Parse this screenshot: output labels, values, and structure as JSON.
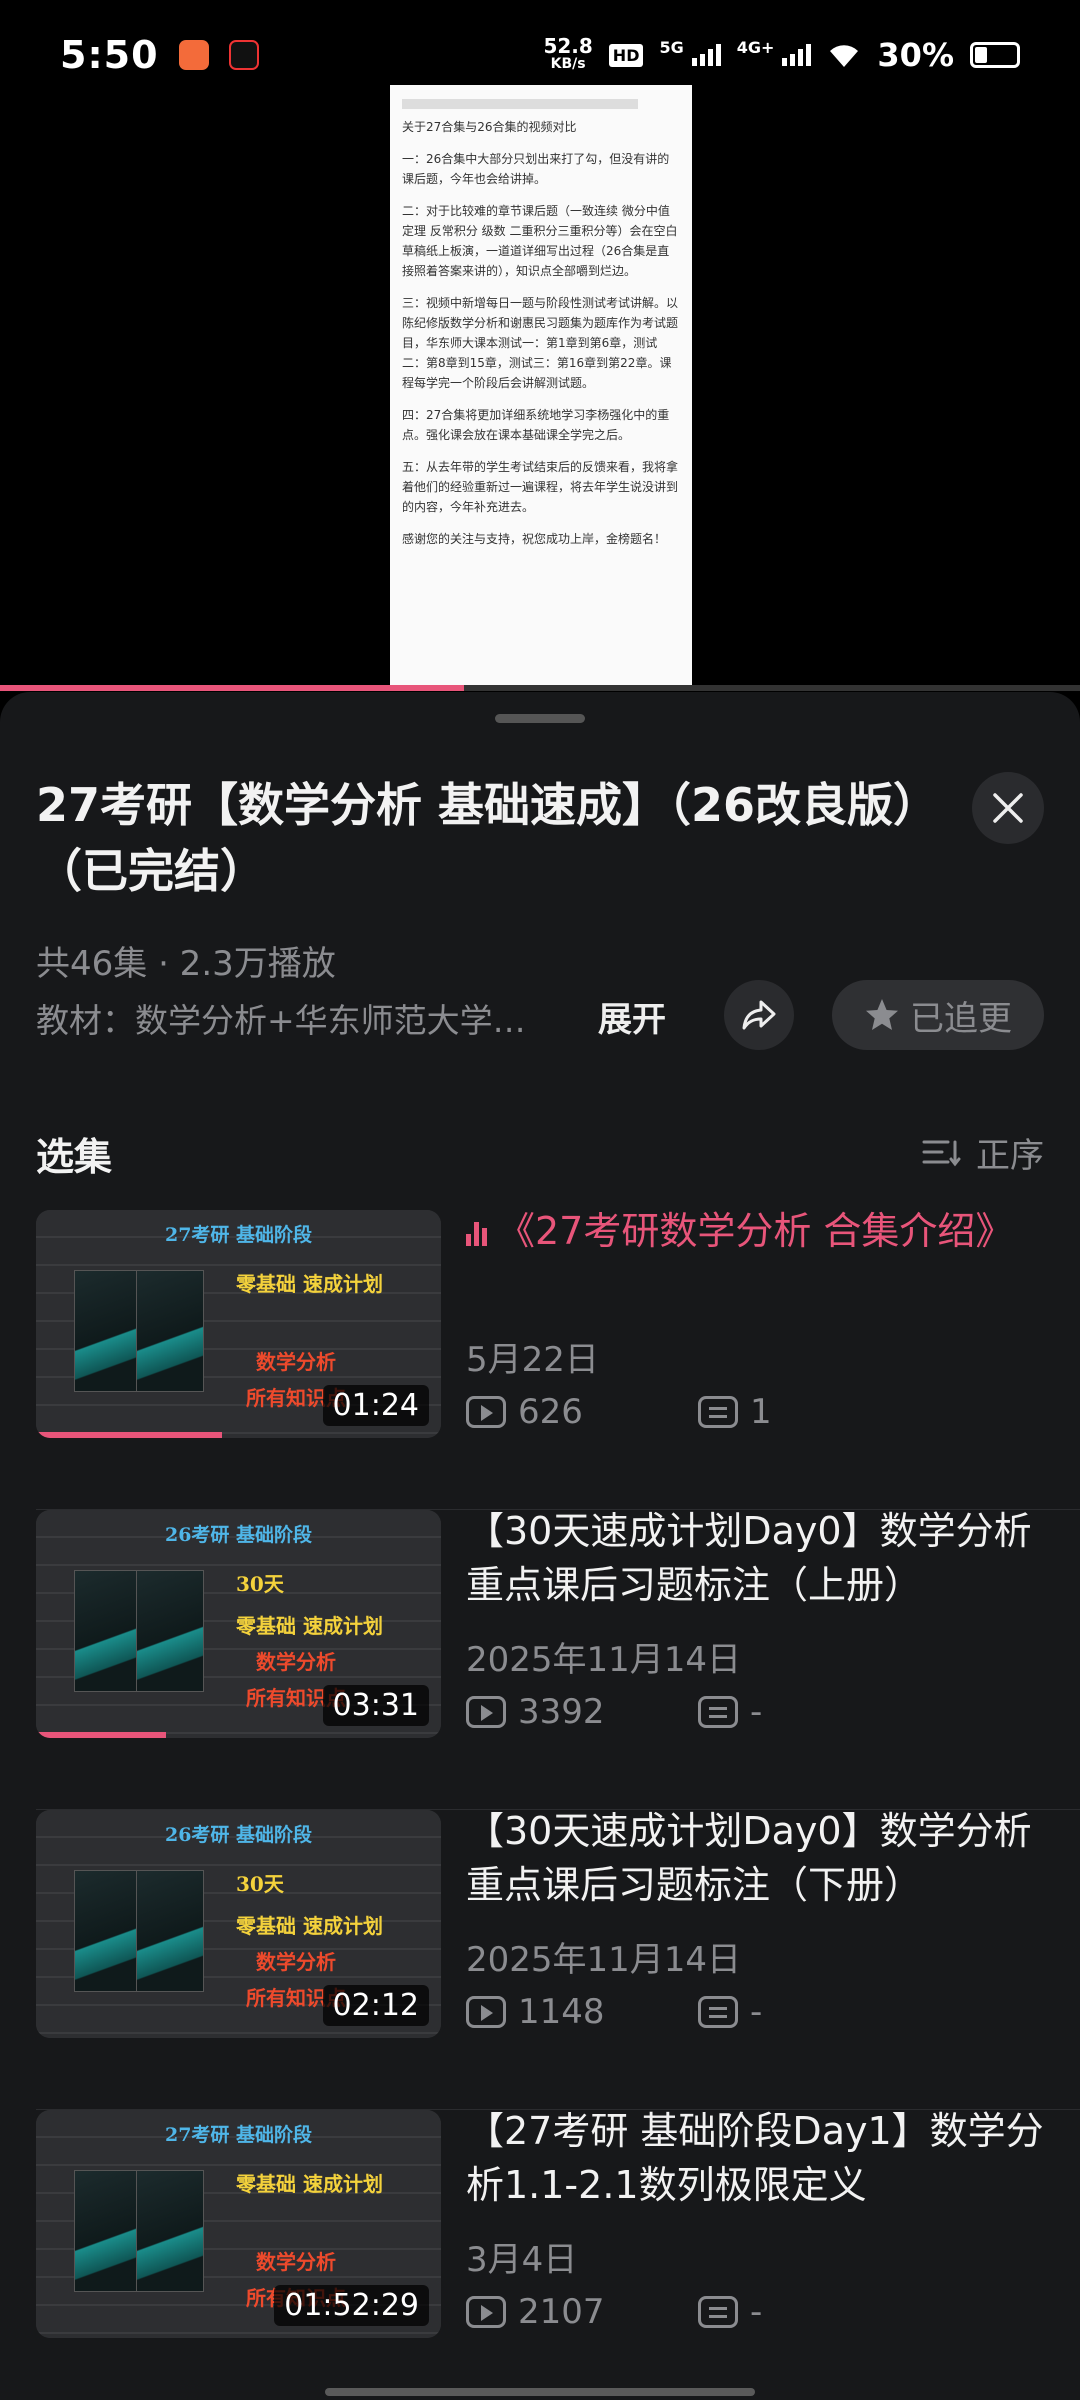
{
  "status_bar": {
    "time": "5:50",
    "net_speed_value": "52.8",
    "net_speed_unit": "KB/s",
    "hd_label": "HD",
    "signal1_label": "5G",
    "signal2_label": "4G+",
    "battery_pct": "30%"
  },
  "video": {
    "doc_lines": [
      "关于27合集与26合集的视频对比",
      "一：26合集中大部分只划出来打了勾，但没有讲的课后题，今年也会给讲掉。",
      "二：对于比较难的章节课后题（一致连续 微分中值定理 反常积分 级数 二重积分三重积分等）会在空白草稿纸上板演，一道道详细写出过程（26合集是直接照着答案来讲的），知识点全部嚼到烂边。",
      "三：视频中新增每日一题与阶段性测试考试讲解。以陈纪修版数学分析和谢惠民习题集为题库作为考试题目，华东师大课本测试一：第1章到第6章，测试二：第8章到15章，测试三：第16章到第22章。课程每学完一个阶段后会讲解测试题。",
      "四：27合集将更加详细系统地学习李杨强化中的重点。强化课会放在课本基础课全学完之后。",
      "五：从去年带的学生考试结束后的反馈来看，我将拿着他们的经验重新过一遍课程，将去年学生说没讲到的内容，今年补充进去。",
      "感谢您的关注与支持，祝您成功上岸，金榜题名！"
    ],
    "progress": 0.43
  },
  "sheet": {
    "title": "27考研【数学分析 基础速成】（26改良版）（已完结）",
    "meta": "共46集 · 2.3万播放",
    "textbook": "教材：数学分析+华东师范大学…",
    "expand_label": "展开",
    "follow_label": "已追更",
    "section_title": "选集",
    "sort_label": "正序"
  },
  "episodes": [
    {
      "title": "《27考研数学分析 合集介绍》",
      "playing": true,
      "date": "5月22日",
      "plays": "626",
      "comments": "1",
      "duration": "01:24",
      "thumb_head": "27考研  基础阶段",
      "thumb_l1": "零基础 速成计划",
      "thumb_l2": "",
      "thumb_l3": "数学分析",
      "thumb_l4": "所有知识点",
      "watched": 0.46
    },
    {
      "title": "【30天速成计划Day0】数学分析 重点课后习题标注（上册）",
      "playing": false,
      "date": "2025年11月14日",
      "plays": "3392",
      "comments": "-",
      "duration": "03:31",
      "thumb_head": "26考研  基础阶段",
      "thumb_l1": "30天",
      "thumb_l2": "零基础 速成计划",
      "thumb_l3": "数学分析",
      "thumb_l4": "所有知识点",
      "watched": 0.32
    },
    {
      "title": "【30天速成计划Day0】数学分析 重点课后习题标注（下册）",
      "playing": false,
      "date": "2025年11月14日",
      "plays": "1148",
      "comments": "-",
      "duration": "02:12",
      "thumb_head": "26考研  基础阶段",
      "thumb_l1": "30天",
      "thumb_l2": "零基础 速成计划",
      "thumb_l3": "数学分析",
      "thumb_l4": "所有知识点",
      "watched": 0
    },
    {
      "title": "【27考研 基础阶段Day1】数学分析1.1-2.1数列极限定义",
      "playing": false,
      "date": "3月4日",
      "plays": "2107",
      "comments": "-",
      "duration": "01:52:29",
      "thumb_head": "27考研  基础阶段",
      "thumb_l1": "零基础 速成计划",
      "thumb_l2": "",
      "thumb_l3": "数学分析",
      "thumb_l4": "所有知识点",
      "watched": 0
    }
  ],
  "colors": {
    "accent": "#e8557a",
    "sheet_bg": "#17181a",
    "muted_text": "#8b8c90"
  },
  "icons": [
    "app-icon-1",
    "tiktok-icon",
    "wifi-icon",
    "battery-icon",
    "close-icon",
    "share-icon",
    "star-icon",
    "sort-icon",
    "play-count-icon",
    "comment-icon",
    "equalizer-icon"
  ]
}
